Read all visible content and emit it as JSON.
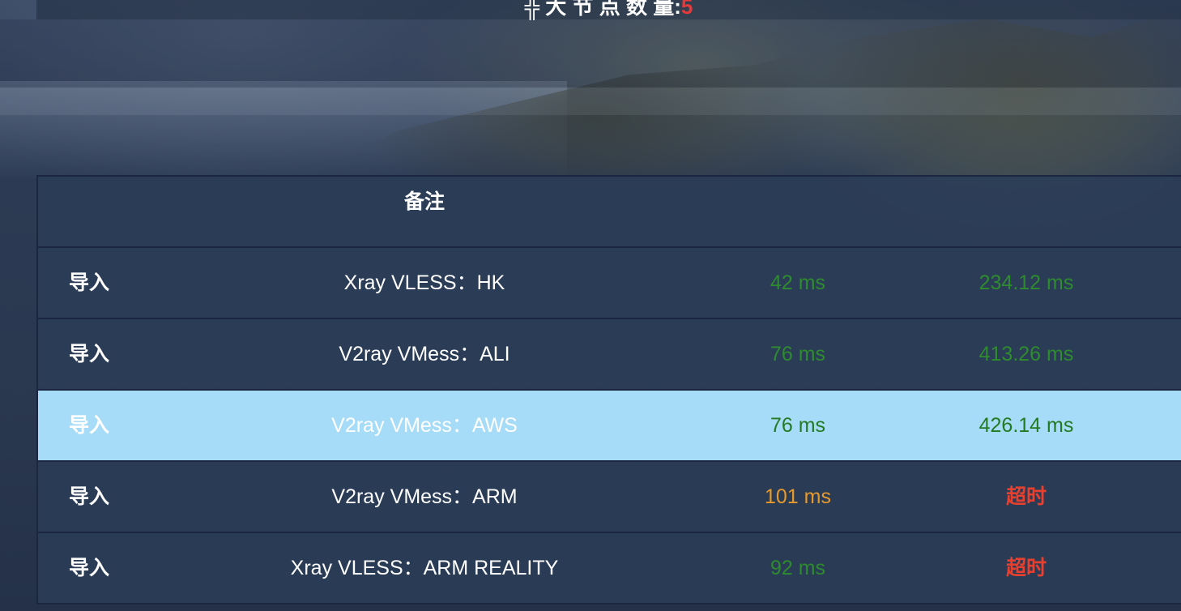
{
  "header": {
    "title_partial": "╬ 大 节 点 数 量:",
    "count_partial": "5"
  },
  "table": {
    "columns": [
      "",
      "备注",
      "",
      ""
    ],
    "rows": [
      {
        "action": "导入",
        "remark": "Xray VLESS：HK",
        "latency": "42 ms",
        "latency_status": "good",
        "speed": "234.12 ms",
        "speed_status": "good",
        "selected": false
      },
      {
        "action": "导入",
        "remark": "V2ray VMess：ALI",
        "latency": "76 ms",
        "latency_status": "good",
        "speed": "413.26 ms",
        "speed_status": "good",
        "selected": false
      },
      {
        "action": "导入",
        "remark": "V2ray VMess：AWS",
        "latency": "76 ms",
        "latency_status": "good",
        "speed": "426.14 ms",
        "speed_status": "good",
        "selected": true
      },
      {
        "action": "导入",
        "remark": "V2ray VMess：ARM",
        "latency": "101 ms",
        "latency_status": "warn",
        "speed": "超时",
        "speed_status": "timeout",
        "selected": false
      },
      {
        "action": "导入",
        "remark": "Xray VLESS：ARM REALITY",
        "latency": "92 ms",
        "latency_status": "good",
        "speed": "超时",
        "speed_status": "timeout",
        "selected": false
      }
    ]
  },
  "colors": {
    "good": "#2e8b2e",
    "warn": "#e79a2c",
    "timeout": "#e8402e",
    "selected_row": "#a6dcf7",
    "row": "#2b3c58"
  }
}
